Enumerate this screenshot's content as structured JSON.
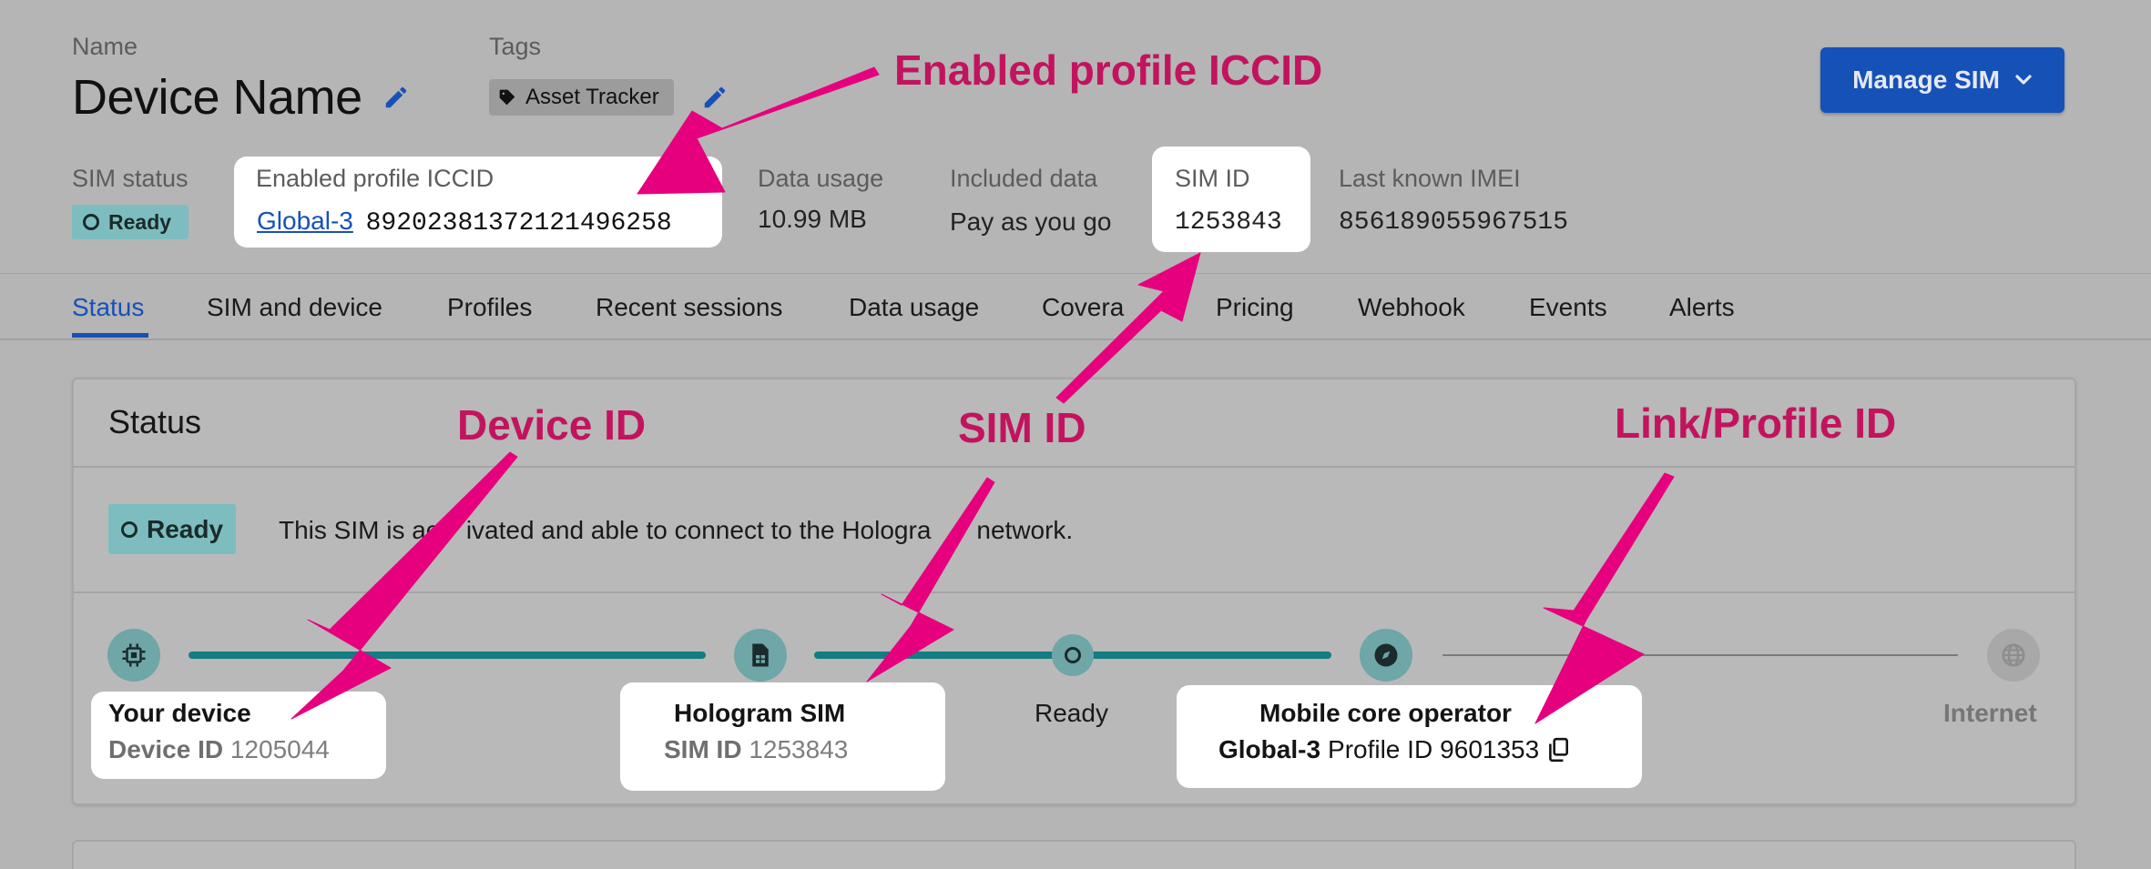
{
  "header": {
    "name_label": "Name",
    "device_name": "Device Name",
    "tags_label": "Tags",
    "tag": "Asset Tracker",
    "manage_sim_label": "Manage SIM"
  },
  "summary": {
    "sim_status_label": "SIM status",
    "sim_status_value": "Ready",
    "iccid_label": "Enabled profile ICCID",
    "iccid_link": "Global-3",
    "iccid_value": "89202381372121496258",
    "data_usage_label": "Data usage",
    "data_usage_value": "10.99 MB",
    "included_data_label": "Included data",
    "included_data_value": "Pay as you go",
    "sim_id_label": "SIM ID",
    "sim_id_value": "1253843",
    "imei_label": "Last known IMEI",
    "imei_value": "856189055967515"
  },
  "tabs": [
    "Status",
    "SIM and device",
    "Profiles",
    "Recent sessions",
    "Data usage",
    "Covera",
    "Pricing",
    "Webhook",
    "Events",
    "Alerts"
  ],
  "status_card": {
    "title": "Status",
    "badge": "Ready",
    "message": "This SIM is activated and able to connect to the Hologram network.",
    "message_visible_start": "This SIM is ac",
    "message_visible_mid": "ivated and able to connect to the Hologra",
    "message_visible_end": "network.",
    "timeline": {
      "device_title": "Your device",
      "device_id_label": "Device ID",
      "device_id": "1205044",
      "sim_title": "Hologram SIM",
      "sim_id_label": "SIM ID",
      "sim_id": "1253843",
      "ready_label": "Ready",
      "operator_title": "Mobile core operator",
      "operator_profile": "Global-3",
      "profile_id_label": "Profile ID",
      "profile_id": "9601353",
      "internet_label": "Internet"
    }
  },
  "annotations": {
    "iccid": "Enabled profile ICCID",
    "device_id": "Device ID",
    "sim_id": "SIM ID",
    "link_profile_id": "Link/Profile ID"
  },
  "colors": {
    "accent_blue": "#1651b8",
    "ready_badge": "#7dbdbf",
    "track_teal": "#147c82",
    "annotation_magenta": "#e6007e",
    "annotation_text": "#c2145e"
  },
  "icons": [
    "pencil-icon",
    "tag-icon",
    "chevron-down-icon",
    "chip-icon",
    "sim-card-icon",
    "compass-icon",
    "globe-icon",
    "copy-icon"
  ]
}
